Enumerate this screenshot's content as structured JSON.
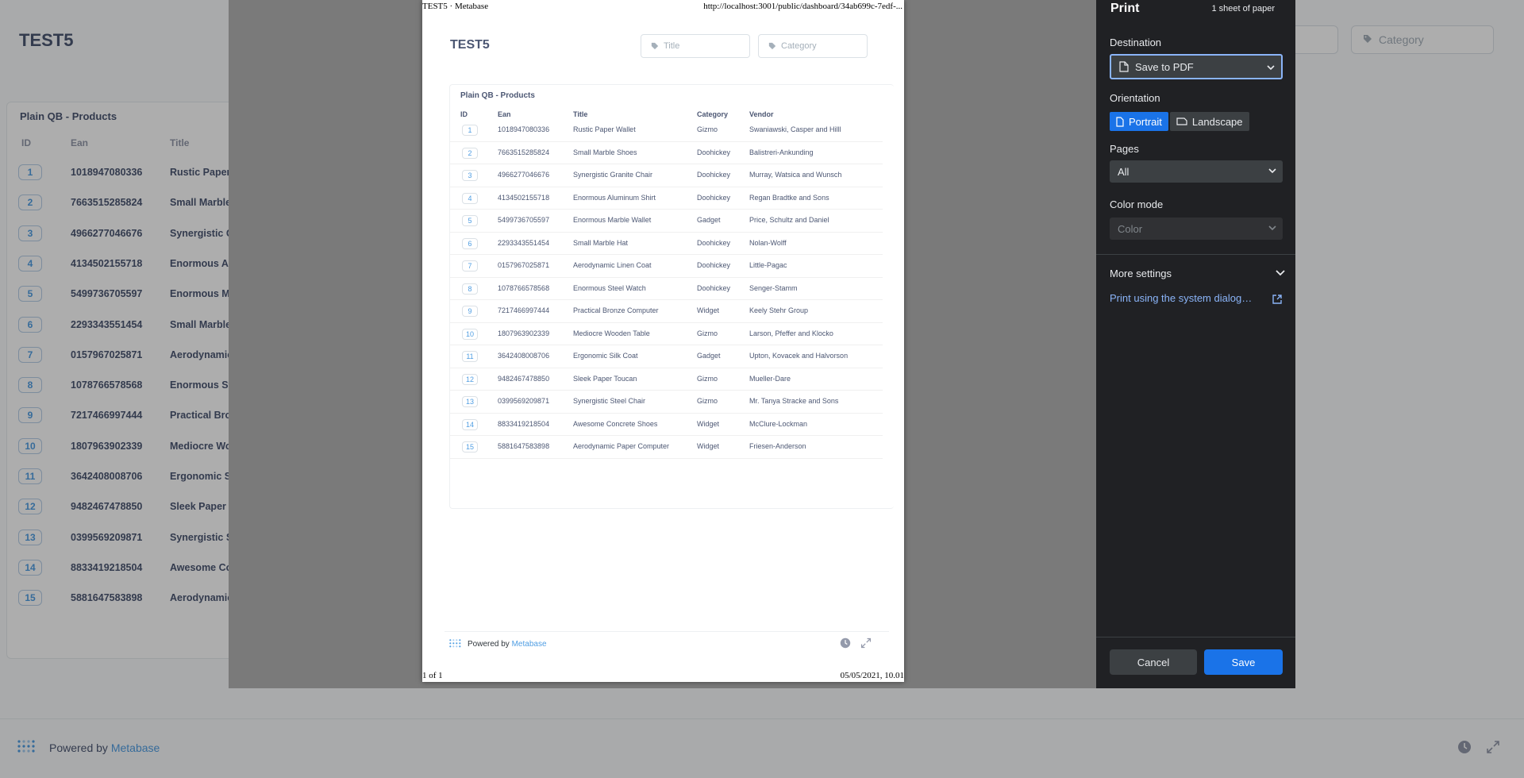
{
  "dashboard": {
    "title": "TEST5",
    "filters": [
      {
        "label": "Title"
      },
      {
        "label": "Category"
      }
    ],
    "card": {
      "title": "Plain QB - Products",
      "columns": [
        "ID",
        "Ean",
        "Title"
      ]
    },
    "footer": {
      "powered_by": "Powered by",
      "brand": "Metabase"
    }
  },
  "products": [
    {
      "id": "1",
      "ean": "1018947080336",
      "title": "Rustic Paper Wallet",
      "category": "Gizmo",
      "vendor": "Swaniawski, Casper and Hilll"
    },
    {
      "id": "2",
      "ean": "7663515285824",
      "title": "Small Marble Shoes",
      "category": "Doohickey",
      "vendor": "Balistreri-Ankunding"
    },
    {
      "id": "3",
      "ean": "4966277046676",
      "title": "Synergistic Granite Chair",
      "category": "Doohickey",
      "vendor": "Murray, Watsica and Wunsch"
    },
    {
      "id": "4",
      "ean": "4134502155718",
      "title": "Enormous Aluminum Shirt",
      "category": "Doohickey",
      "vendor": "Regan Bradtke and Sons"
    },
    {
      "id": "5",
      "ean": "5499736705597",
      "title": "Enormous Marble Wallet",
      "category": "Gadget",
      "vendor": "Price, Schultz and Daniel"
    },
    {
      "id": "6",
      "ean": "2293343551454",
      "title": "Small Marble Hat",
      "category": "Doohickey",
      "vendor": "Nolan-Wolff"
    },
    {
      "id": "7",
      "ean": "0157967025871",
      "title": "Aerodynamic Linen Coat",
      "category": "Doohickey",
      "vendor": "Little-Pagac"
    },
    {
      "id": "8",
      "ean": "1078766578568",
      "title": "Enormous Steel Watch",
      "category": "Doohickey",
      "vendor": "Senger-Stamm"
    },
    {
      "id": "9",
      "ean": "7217466997444",
      "title": "Practical Bronze Computer",
      "category": "Widget",
      "vendor": "Keely Stehr Group"
    },
    {
      "id": "10",
      "ean": "1807963902339",
      "title": "Mediocre Wooden Table",
      "category": "Gizmo",
      "vendor": "Larson, Pfeffer and Klocko"
    },
    {
      "id": "11",
      "ean": "3642408008706",
      "title": "Ergonomic Silk Coat",
      "category": "Gadget",
      "vendor": "Upton, Kovacek and Halvorson"
    },
    {
      "id": "12",
      "ean": "9482467478850",
      "title": "Sleek Paper Toucan",
      "category": "Gizmo",
      "vendor": "Mueller-Dare"
    },
    {
      "id": "13",
      "ean": "0399569209871",
      "title": "Synergistic Steel Chair",
      "category": "Gizmo",
      "vendor": "Mr. Tanya Stracke and Sons"
    },
    {
      "id": "14",
      "ean": "8833419218504",
      "title": "Awesome Concrete Shoes",
      "category": "Widget",
      "vendor": "McClure-Lockman"
    },
    {
      "id": "15",
      "ean": "5881647583898",
      "title": "Aerodynamic Paper Computer",
      "category": "Widget",
      "vendor": "Friesen-Anderson"
    }
  ],
  "bg_titles_truncated": [
    "Rustic Paper W",
    "Small Marble S",
    "Synergistic Gra",
    "Enormous Alu",
    "Enormous Mar",
    "Small Marble H",
    "Aerodynamic L",
    "Enormous Stee",
    "Practical Bron",
    "Mediocre Woo",
    "Ergonomic Silk",
    "Sleek Paper To",
    "Synergistic Ste",
    "Awesome Con",
    "Aerodynamic P"
  ],
  "print_page": {
    "header_left": "TEST5 · Metabase",
    "header_right": "http://localhost:3001/public/dashboard/34ab699c-7edf-...",
    "footer_left": "1 of 1",
    "footer_right": "05/05/2021, 10.01",
    "columns": [
      "ID",
      "Ean",
      "Title",
      "Category",
      "Vendor"
    ]
  },
  "print_dialog": {
    "title": "Print",
    "sheets": "1 sheet of paper",
    "destination_label": "Destination",
    "destination_value": "Save to PDF",
    "orientation_label": "Orientation",
    "orientation_portrait": "Portrait",
    "orientation_landscape": "Landscape",
    "orientation_selected": "Portrait",
    "pages_label": "Pages",
    "pages_value": "All",
    "color_label": "Color mode",
    "color_value": "Color",
    "more_settings": "More settings",
    "system_dialog": "Print using the system dialog…",
    "cancel": "Cancel",
    "save": "Save"
  },
  "colors": {
    "brand": "#509ee3",
    "dialog_bg": "#202124",
    "dialog_accent": "#1a73e8"
  }
}
